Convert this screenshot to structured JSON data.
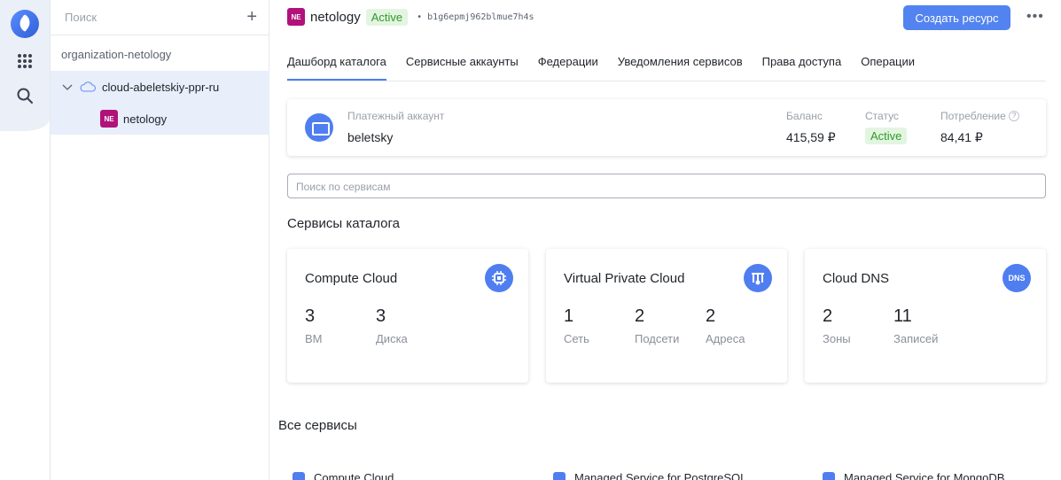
{
  "colors": {
    "accent": "#5283f0",
    "status_green": "#2f9a2a",
    "folder_badge": "#b0127a"
  },
  "rail": {
    "icons": [
      "cloud-logo-icon",
      "apps-grid-icon",
      "search-icon"
    ]
  },
  "tree": {
    "search_placeholder": "Поиск",
    "add_icon": "+",
    "organization": "organization-netology",
    "cloud": "cloud-abeletskiy-ppr-ru",
    "folder_badge": "NE",
    "folder": "netology"
  },
  "header": {
    "badge": "NE",
    "name": "netology",
    "status": "Active",
    "separator": "•",
    "id": "b1g6epmj962blmue7h4s",
    "create_button": "Создать ресурс",
    "more": "•••"
  },
  "tabs": [
    {
      "label": "Дашборд каталога",
      "active": true
    },
    {
      "label": "Сервисные аккаунты",
      "active": false
    },
    {
      "label": "Федерации",
      "active": false
    },
    {
      "label": "Уведомления сервисов",
      "active": false
    },
    {
      "label": "Права доступа",
      "active": false
    },
    {
      "label": "Операции",
      "active": false
    }
  ],
  "billing": {
    "account_label": "Платежный аккаунт",
    "account_name": "beletsky",
    "balance_label": "Баланс",
    "balance": "415,59 ₽",
    "status_label": "Статус",
    "status": "Active",
    "consumption_label": "Потребление",
    "consumption": "84,41 ₽",
    "help": "?"
  },
  "services_search_placeholder": "Поиск по сервисам",
  "catalog_title": "Сервисы каталога",
  "cards": [
    {
      "name": "Compute Cloud",
      "icon": "chip-icon",
      "icon_text": "",
      "stats": [
        {
          "value": "3",
          "label": "ВМ"
        },
        {
          "value": "3",
          "label": "Диска"
        }
      ]
    },
    {
      "name": "Virtual Private Cloud",
      "icon": "network-icon",
      "icon_text": "",
      "stats": [
        {
          "value": "1",
          "label": "Сеть"
        },
        {
          "value": "2",
          "label": "Подсети"
        },
        {
          "value": "2",
          "label": "Адреса"
        }
      ]
    },
    {
      "name": "Cloud DNS",
      "icon": "dns-icon",
      "icon_text": "DNS",
      "stats": [
        {
          "value": "2",
          "label": "Зоны"
        },
        {
          "value": "11",
          "label": "Записей"
        }
      ]
    }
  ],
  "all_services_title": "Все сервисы",
  "all_services": [
    "Compute Cloud",
    "Managed Service for PostgreSQL",
    "Managed Service for MongoDB"
  ]
}
